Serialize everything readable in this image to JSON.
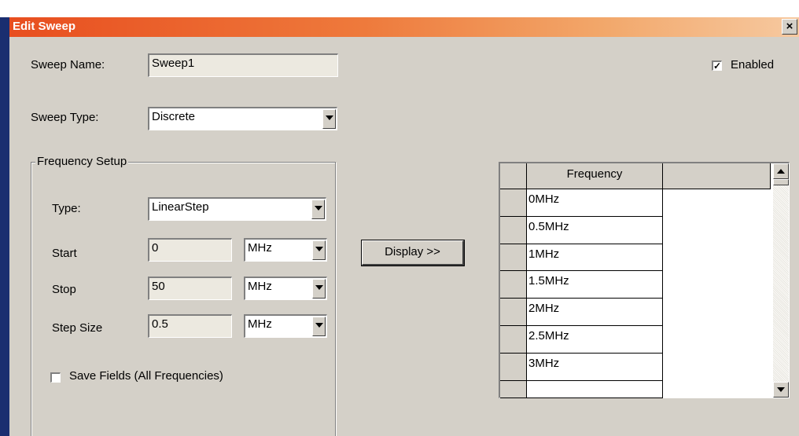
{
  "window": {
    "title": "Edit Sweep",
    "close_glyph": "×"
  },
  "sweep_name": {
    "label": "Sweep Name:",
    "value": "Sweep1"
  },
  "enabled": {
    "label": "Enabled",
    "checked": true,
    "check_glyph": "✓"
  },
  "sweep_type": {
    "label": "Sweep Type:",
    "value": "Discrete"
  },
  "frequency_setup": {
    "group_label": "Frequency Setup",
    "type": {
      "label": "Type:",
      "value": "LinearStep"
    },
    "start": {
      "label": "Start",
      "value": "0",
      "unit": "MHz"
    },
    "stop": {
      "label": "Stop",
      "value": "50",
      "unit": "MHz"
    },
    "step_size": {
      "label": "Step Size",
      "value": "0.5",
      "unit": "MHz"
    },
    "save_fields": {
      "label": "Save Fields (All Frequencies)",
      "checked": false
    }
  },
  "display_button": {
    "label": "Display >>"
  },
  "frequency_table": {
    "header": "Frequency",
    "rows": [
      "0MHz",
      "0.5MHz",
      "1MHz",
      "1.5MHz",
      "2MHz",
      "2.5MHz",
      "3MHz",
      ""
    ]
  },
  "colors": {
    "titlebar_start": "#e84e1f",
    "dialog_face": "#d4d0c8",
    "background": "#1a2e70"
  }
}
